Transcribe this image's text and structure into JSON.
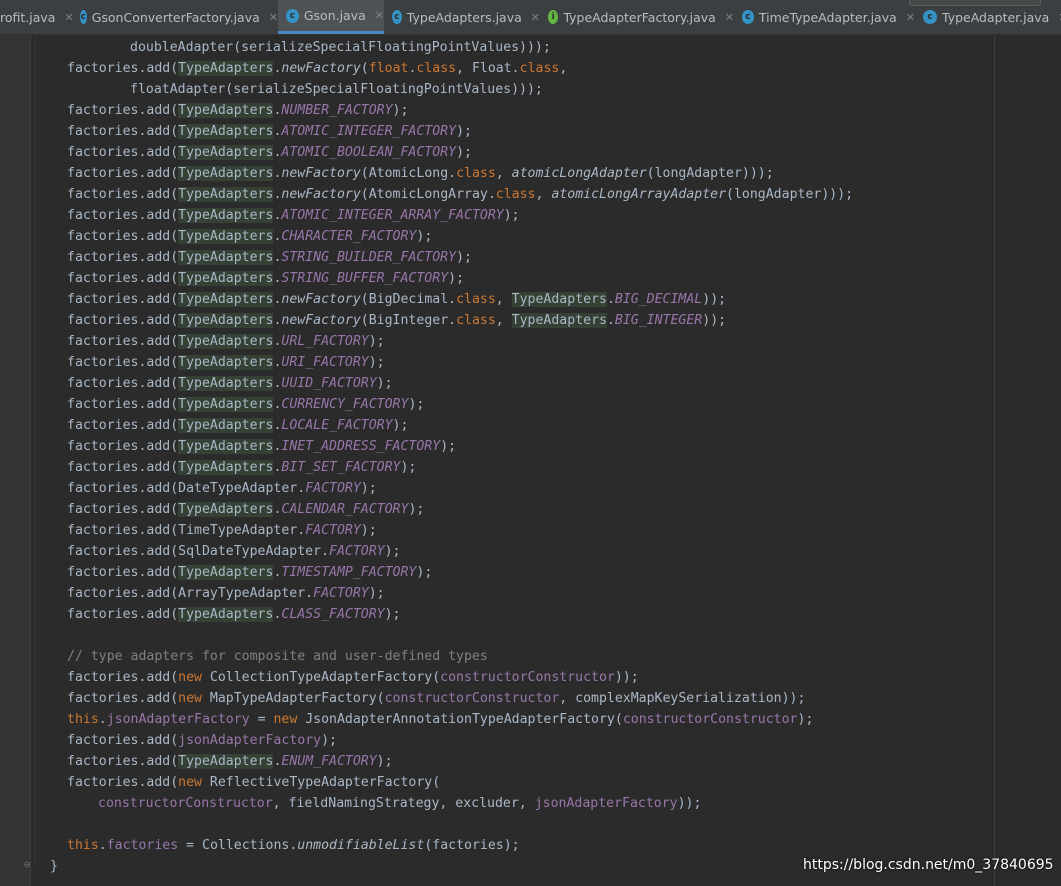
{
  "tabs": [
    {
      "label": "rofit.java",
      "icon": ""
    },
    {
      "label": "GsonConverterFactory.java",
      "icon": "c"
    },
    {
      "label": "Gson.java",
      "icon": "c",
      "active": true
    },
    {
      "label": "TypeAdapters.java",
      "icon": "c"
    },
    {
      "label": "TypeAdapterFactory.java",
      "icon": "i"
    },
    {
      "label": "TimeTypeAdapter.java",
      "icon": "c"
    },
    {
      "label": "TypeAdapter.java",
      "icon": "c"
    }
  ],
  "colors": {
    "editor_bg": "#2b2b2b",
    "keyword": "#cc7832",
    "static_field": "#9876aa",
    "text": "#a9b7c6",
    "comment": "#808080",
    "usage_highlight": "#344134",
    "active_tab_underline": "#4a88c7"
  },
  "code_lines": [
    [
      {
        "t": "doubleAdapter(serializeSpecialFloatingPointValues)));"
      }
    ],
    [
      {
        "t": "factories.add("
      },
      {
        "t": "TypeAdapters",
        "k": "hl"
      },
      {
        "t": "."
      },
      {
        "t": "newFactory",
        "k": "it"
      },
      {
        "t": "("
      },
      {
        "t": "float",
        "k": "kw"
      },
      {
        "t": "."
      },
      {
        "t": "class",
        "k": "kw"
      },
      {
        "t": ", Float."
      },
      {
        "t": "class",
        "k": "kw"
      },
      {
        "t": ","
      }
    ],
    [
      {
        "t": "floatAdapter(serializeSpecialFloatingPointValues)));"
      }
    ],
    [
      {
        "t": "factories.add("
      },
      {
        "t": "TypeAdapters",
        "k": "hl"
      },
      {
        "t": "."
      },
      {
        "t": "NUMBER_FACTORY",
        "k": "st"
      },
      {
        "t": ");"
      }
    ],
    [
      {
        "t": "factories.add("
      },
      {
        "t": "TypeAdapters",
        "k": "hl"
      },
      {
        "t": "."
      },
      {
        "t": "ATOMIC_INTEGER_FACTORY",
        "k": "st"
      },
      {
        "t": ");"
      }
    ],
    [
      {
        "t": "factories.add("
      },
      {
        "t": "TypeAdapters",
        "k": "hl"
      },
      {
        "t": "."
      },
      {
        "t": "ATOMIC_BOOLEAN_FACTORY",
        "k": "st"
      },
      {
        "t": ");"
      }
    ],
    [
      {
        "t": "factories.add("
      },
      {
        "t": "TypeAdapters",
        "k": "hl"
      },
      {
        "t": "."
      },
      {
        "t": "newFactory",
        "k": "it"
      },
      {
        "t": "(AtomicLong."
      },
      {
        "t": "class",
        "k": "kw"
      },
      {
        "t": ", "
      },
      {
        "t": "atomicLongAdapter",
        "k": "it"
      },
      {
        "t": "(longAdapter)));"
      }
    ],
    [
      {
        "t": "factories.add("
      },
      {
        "t": "TypeAdapters",
        "k": "hl"
      },
      {
        "t": "."
      },
      {
        "t": "newFactory",
        "k": "it"
      },
      {
        "t": "(AtomicLongArray."
      },
      {
        "t": "class",
        "k": "kw"
      },
      {
        "t": ", "
      },
      {
        "t": "atomicLongArrayAdapter",
        "k": "it"
      },
      {
        "t": "(longAdapter)));"
      }
    ],
    [
      {
        "t": "factories.add("
      },
      {
        "t": "TypeAdapters",
        "k": "hl"
      },
      {
        "t": "."
      },
      {
        "t": "ATOMIC_INTEGER_ARRAY_FACTORY",
        "k": "st"
      },
      {
        "t": ");"
      }
    ],
    [
      {
        "t": "factories.add("
      },
      {
        "t": "TypeAdapters",
        "k": "hl"
      },
      {
        "t": "."
      },
      {
        "t": "CHARACTER_FACTORY",
        "k": "st"
      },
      {
        "t": ");"
      }
    ],
    [
      {
        "t": "factories.add("
      },
      {
        "t": "TypeAdapters",
        "k": "hl"
      },
      {
        "t": "."
      },
      {
        "t": "STRING_BUILDER_FACTORY",
        "k": "st"
      },
      {
        "t": ");"
      }
    ],
    [
      {
        "t": "factories.add("
      },
      {
        "t": "TypeAdapters",
        "k": "hl"
      },
      {
        "t": "."
      },
      {
        "t": "STRING_BUFFER_FACTORY",
        "k": "st"
      },
      {
        "t": ");"
      }
    ],
    [
      {
        "t": "factories.add("
      },
      {
        "t": "TypeAdapters",
        "k": "hl"
      },
      {
        "t": "."
      },
      {
        "t": "newFactory",
        "k": "it"
      },
      {
        "t": "(BigDecimal."
      },
      {
        "t": "class",
        "k": "kw"
      },
      {
        "t": ", "
      },
      {
        "t": "TypeAdapters",
        "k": "hl"
      },
      {
        "t": "."
      },
      {
        "t": "BIG_DECIMAL",
        "k": "st"
      },
      {
        "t": "));"
      }
    ],
    [
      {
        "t": "factories.add("
      },
      {
        "t": "TypeAdapters",
        "k": "hl"
      },
      {
        "t": "."
      },
      {
        "t": "newFactory",
        "k": "it"
      },
      {
        "t": "(BigInteger."
      },
      {
        "t": "class",
        "k": "kw"
      },
      {
        "t": ", "
      },
      {
        "t": "TypeAdapters",
        "k": "hl"
      },
      {
        "t": "."
      },
      {
        "t": "BIG_INTEGER",
        "k": "st"
      },
      {
        "t": "));"
      }
    ],
    [
      {
        "t": "factories.add("
      },
      {
        "t": "TypeAdapters",
        "k": "hl"
      },
      {
        "t": "."
      },
      {
        "t": "URL_FACTORY",
        "k": "st"
      },
      {
        "t": ");"
      }
    ],
    [
      {
        "t": "factories.add("
      },
      {
        "t": "TypeAdapters",
        "k": "hl"
      },
      {
        "t": "."
      },
      {
        "t": "URI_FACTORY",
        "k": "st"
      },
      {
        "t": ");"
      }
    ],
    [
      {
        "t": "factories.add("
      },
      {
        "t": "TypeAdapters",
        "k": "hl"
      },
      {
        "t": "."
      },
      {
        "t": "UUID_FACTORY",
        "k": "st"
      },
      {
        "t": ");"
      }
    ],
    [
      {
        "t": "factories.add("
      },
      {
        "t": "TypeAdapters",
        "k": "hl"
      },
      {
        "t": "."
      },
      {
        "t": "CURRENCY_FACTORY",
        "k": "st"
      },
      {
        "t": ");"
      }
    ],
    [
      {
        "t": "factories.add("
      },
      {
        "t": "TypeAdapters",
        "k": "hl"
      },
      {
        "t": "."
      },
      {
        "t": "LOCALE_FACTORY",
        "k": "st"
      },
      {
        "t": ");"
      }
    ],
    [
      {
        "t": "factories.add("
      },
      {
        "t": "TypeAdapters",
        "k": "hl"
      },
      {
        "t": "."
      },
      {
        "t": "INET_ADDRESS_FACTORY",
        "k": "st"
      },
      {
        "t": ");"
      }
    ],
    [
      {
        "t": "factories.add("
      },
      {
        "t": "TypeAdapters",
        "k": "hl"
      },
      {
        "t": "."
      },
      {
        "t": "BIT_SET_FACTORY",
        "k": "st"
      },
      {
        "t": ");"
      }
    ],
    [
      {
        "t": "factories.add(DateTypeAdapter."
      },
      {
        "t": "FACTORY",
        "k": "st"
      },
      {
        "t": ");"
      }
    ],
    [
      {
        "t": "factories.add("
      },
      {
        "t": "TypeAdapters",
        "k": "hl"
      },
      {
        "t": "."
      },
      {
        "t": "CALENDAR_FACTORY",
        "k": "st"
      },
      {
        "t": ");"
      }
    ],
    [
      {
        "t": "factories.add(TimeTypeAdapter."
      },
      {
        "t": "FACTORY",
        "k": "st"
      },
      {
        "t": ");"
      }
    ],
    [
      {
        "t": "factories.add(SqlDateTypeAdapter."
      },
      {
        "t": "FACTORY",
        "k": "st"
      },
      {
        "t": ");"
      }
    ],
    [
      {
        "t": "factories.add("
      },
      {
        "t": "TypeAdapters",
        "k": "hl"
      },
      {
        "t": "."
      },
      {
        "t": "TIMESTAMP_FACTORY",
        "k": "st"
      },
      {
        "t": ");"
      }
    ],
    [
      {
        "t": "factories.add(ArrayTypeAdapter."
      },
      {
        "t": "FACTORY",
        "k": "st"
      },
      {
        "t": ");"
      }
    ],
    [
      {
        "t": "factories.add("
      },
      {
        "t": "TypeAdapters",
        "k": "hl"
      },
      {
        "t": "."
      },
      {
        "t": "CLASS_FACTORY",
        "k": "st"
      },
      {
        "t": ");"
      }
    ],
    [],
    [
      {
        "t": "// type adapters for composite and user-defined types",
        "k": "cm"
      }
    ],
    [
      {
        "t": "factories.add("
      },
      {
        "t": "new ",
        "k": "kw"
      },
      {
        "t": "CollectionTypeAdapterFactory("
      },
      {
        "t": "constructorConstructor",
        "k": "fl"
      },
      {
        "t": "));"
      }
    ],
    [
      {
        "t": "factories.add("
      },
      {
        "t": "new ",
        "k": "kw"
      },
      {
        "t": "MapTypeAdapterFactory("
      },
      {
        "t": "constructorConstructor",
        "k": "fl"
      },
      {
        "t": ", complexMapKeySerialization));"
      }
    ],
    [
      {
        "t": "this",
        "k": "kw"
      },
      {
        "t": "."
      },
      {
        "t": "jsonAdapterFactory",
        "k": "fl"
      },
      {
        "t": " = "
      },
      {
        "t": "new ",
        "k": "kw"
      },
      {
        "t": "JsonAdapterAnnotationTypeAdapterFactory("
      },
      {
        "t": "constructorConstructor",
        "k": "fl"
      },
      {
        "t": ");"
      }
    ],
    [
      {
        "t": "factories.add("
      },
      {
        "t": "jsonAdapterFactory",
        "k": "fl"
      },
      {
        "t": ");"
      }
    ],
    [
      {
        "t": "factories.add("
      },
      {
        "t": "TypeAdapters",
        "k": "hl"
      },
      {
        "t": "."
      },
      {
        "t": "ENUM_FACTORY",
        "k": "st"
      },
      {
        "t": ");"
      }
    ],
    [
      {
        "t": "factories.add("
      },
      {
        "t": "new ",
        "k": "kw"
      },
      {
        "t": "ReflectiveTypeAdapterFactory("
      }
    ],
    [
      {
        "t": "constructorConstructor",
        "k": "fl"
      },
      {
        "t": ", fieldNamingStrategy, excluder, "
      },
      {
        "t": "jsonAdapterFactory",
        "k": "fl"
      },
      {
        "t": "));"
      }
    ],
    [],
    [
      {
        "t": "this",
        "k": "kw"
      },
      {
        "t": "."
      },
      {
        "t": "factories",
        "k": "fl"
      },
      {
        "t": " = Collections."
      },
      {
        "t": "unmodifiableList",
        "k": "it"
      },
      {
        "t": "(factories);"
      }
    ],
    [
      {
        "t": "}"
      }
    ]
  ],
  "watermark": "https://blog.csdn.net/m0_37840695"
}
